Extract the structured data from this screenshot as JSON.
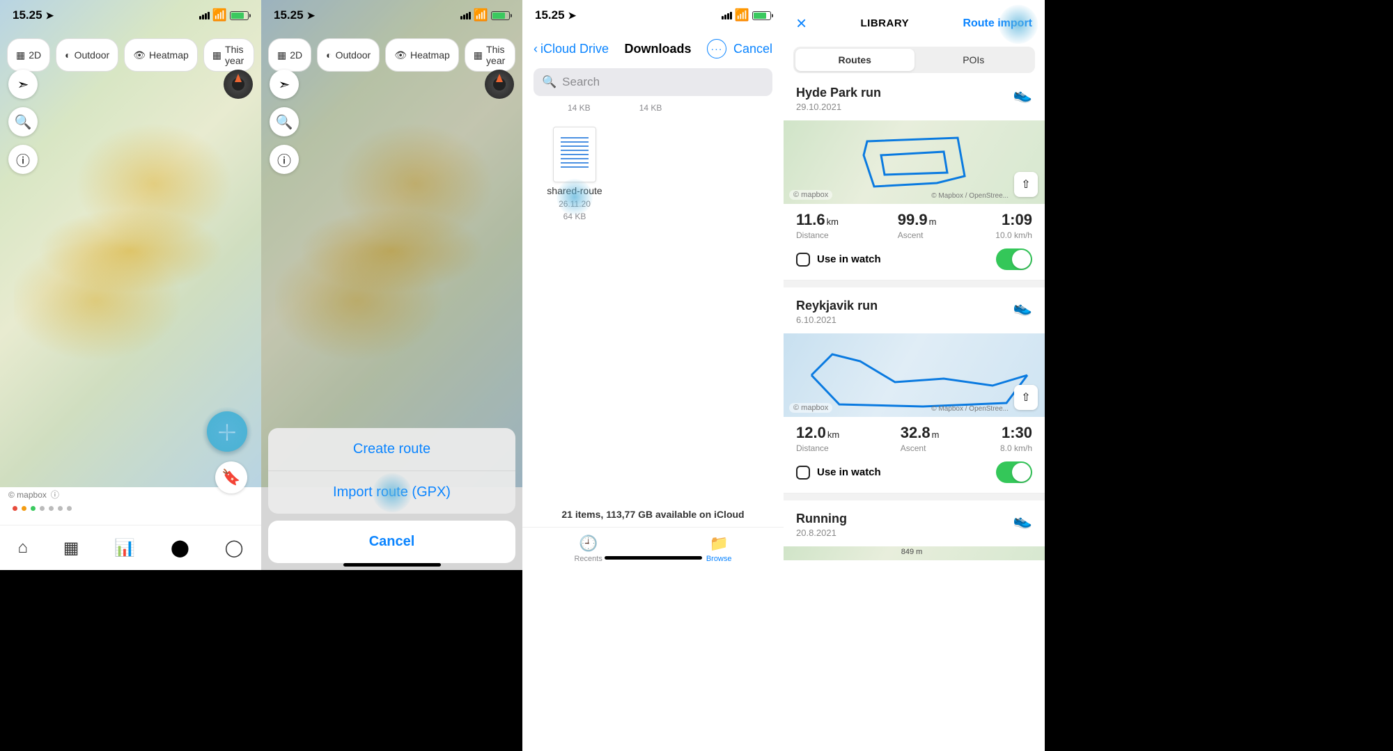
{
  "status": {
    "time": "15.25",
    "signal": 4,
    "wifi": true,
    "battery_pct": 70
  },
  "map_dimmed_status": {
    "time": "15.25"
  },
  "files_status": {
    "time": "15.25"
  },
  "chips": {
    "view": "2D",
    "type": "Outdoor",
    "layer": "Heatmap",
    "period": "This year"
  },
  "attrib": {
    "mapbox": "© mapbox"
  },
  "action_sheet": {
    "create": "Create route",
    "import": "Import route (GPX)",
    "cancel": "Cancel"
  },
  "files": {
    "back": "iCloud Drive",
    "title": "Downloads",
    "more": "···",
    "cancel": "Cancel",
    "search_placeholder": "Search",
    "prev_row_sizes": [
      "14 KB",
      "14 KB"
    ],
    "item": {
      "name": "shared-route",
      "date": "26.11.20",
      "size": "64 KB"
    },
    "footer": "21 items, 113,77 GB available on iCloud",
    "tabs": {
      "recents": "Recents",
      "browse": "Browse"
    }
  },
  "library": {
    "close": "×",
    "title": "LIBRARY",
    "import": "Route import",
    "segments": {
      "routes": "Routes",
      "pois": "POIs"
    },
    "routes": [
      {
        "title": "Hyde Park run",
        "date": "29.10.2021",
        "distance_val": "11.6",
        "distance_unit": "km",
        "distance_label": "Distance",
        "ascent_val": "99.9",
        "ascent_unit": "m",
        "ascent_label": "Ascent",
        "time_val": "1:09",
        "speed": "10.0 km/h",
        "watch_label": "Use in watch",
        "watch_on": true,
        "attr_l": "© mapbox",
        "attr_r": "© Mapbox / OpenStree..."
      },
      {
        "title": "Reykjavik run",
        "date": "6.10.2021",
        "distance_val": "12.0",
        "distance_unit": "km",
        "distance_label": "Distance",
        "ascent_val": "32.8",
        "ascent_unit": "m",
        "ascent_label": "Ascent",
        "time_val": "1:30",
        "speed": "8.0 km/h",
        "watch_label": "Use in watch",
        "watch_on": true,
        "attr_l": "© mapbox",
        "attr_r": "© Mapbox / OpenStree..."
      },
      {
        "title": "Running",
        "date": "20.8.2021",
        "peak_label": "849 m"
      }
    ]
  }
}
